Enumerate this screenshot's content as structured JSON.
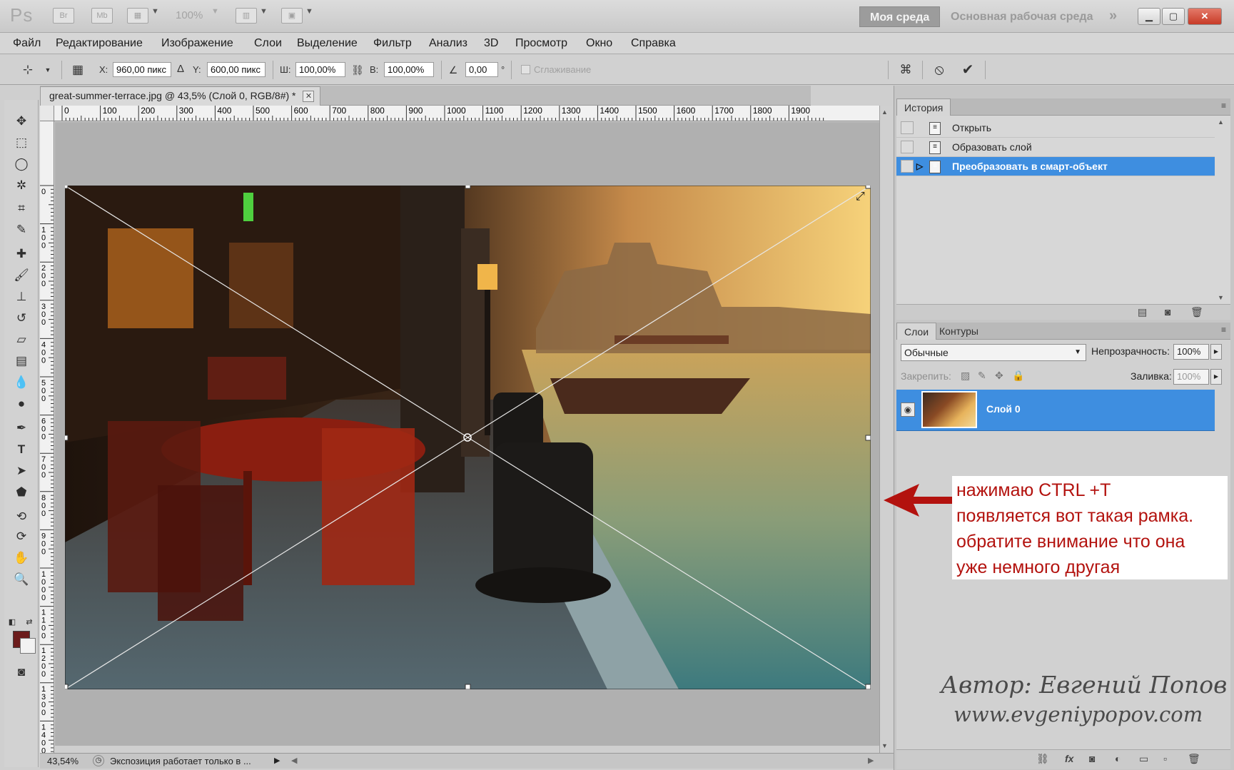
{
  "titlebar": {
    "logo": "Ps",
    "br_label": "Br",
    "mb_label": "Mb",
    "zoom": "100%",
    "workspace_active": "Моя среда",
    "workspace_main": "Основная рабочая среда",
    "more": "»"
  },
  "menu": [
    "Файл",
    "Редактирование",
    "Изображение",
    "Слои",
    "Выделение",
    "Фильтр",
    "Анализ",
    "3D",
    "Просмотр",
    "Окно",
    "Справка"
  ],
  "options": {
    "x_label": "X:",
    "x_value": "960,00 пикс",
    "delta": "Δ",
    "y_label": "Y:",
    "y_value": "600,00 пикс",
    "w_label": "Ш:",
    "w_value": "100,00%",
    "h_label": "В:",
    "h_value": "100,00%",
    "angle_value": "0,00",
    "degree": "°",
    "antialias_label": "Сглаживание"
  },
  "document": {
    "tab_title": "great-summer-terrace.jpg @ 43,5% (Слой 0, RGB/8#) *",
    "ruler_top": [
      "0",
      "100",
      "200",
      "300",
      "400",
      "500",
      "600",
      "700",
      "800",
      "900",
      "1000",
      "1100",
      "1200",
      "1300",
      "1400",
      "1500",
      "1600",
      "1700",
      "1800",
      "1900"
    ],
    "ruler_left": [
      "0",
      "100",
      "200",
      "300",
      "400",
      "500",
      "600",
      "700",
      "800",
      "900",
      "1000",
      "1100",
      "1200",
      "1300",
      "1400"
    ],
    "status_zoom": "43,54%",
    "status_text": "Экспозиция работает только в ..."
  },
  "colors": {
    "foreground": "#6c1c1c",
    "background": "#f2f2f2",
    "selection": "#3e8ee0"
  },
  "history": {
    "tab": "История",
    "items": [
      "Открыть",
      "Образовать слой",
      "Преобразовать в смарт-объект"
    ]
  },
  "layers": {
    "tab_layers": "Слои",
    "tab_paths": "Контуры",
    "blend_mode": "Обычные",
    "opacity_label": "Непрозрачность:",
    "opacity_value": "100%",
    "lock_label": "Закрепить:",
    "fill_label": "Заливка:",
    "fill_value": "100%",
    "layer_name": "Слой 0"
  },
  "annotation": {
    "lines": [
      "нажимаю CTRL +T",
      "появляется вот такая рамка.",
      "обратите внимание что она",
      "уже немного другая"
    ]
  },
  "credit": {
    "author": "Автор: Евгений Попов",
    "site": "www.evgeniypopov.com"
  }
}
